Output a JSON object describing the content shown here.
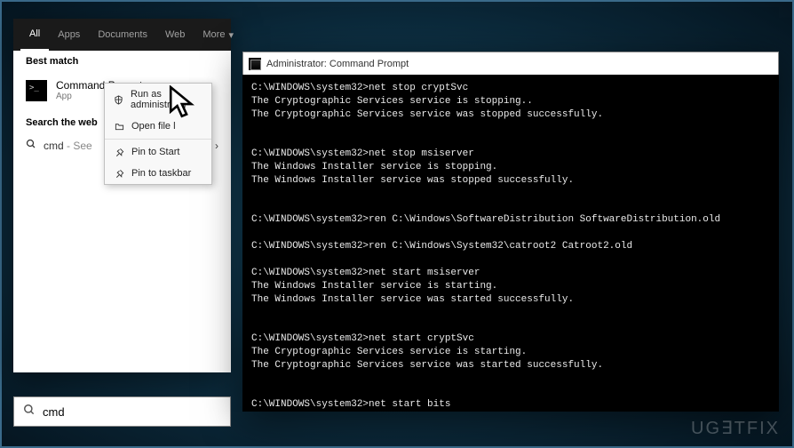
{
  "search_panel": {
    "tabs": [
      "All",
      "Apps",
      "Documents",
      "Web",
      "More"
    ],
    "active_tab": "All",
    "best_match_label": "Best match",
    "result": {
      "title": "Command Prompt",
      "subtitle": "App"
    },
    "search_web_label": "Search the web",
    "web_result": {
      "prefix": "cmd",
      "suffix": "- See"
    }
  },
  "context_menu": {
    "items": [
      {
        "label": "Run as administrator",
        "icon": "shield"
      },
      {
        "label": "Open file l",
        "icon": "folder"
      },
      {
        "label": "Pin to Start",
        "icon": "pin"
      },
      {
        "label": "Pin to taskbar",
        "icon": "pin"
      }
    ]
  },
  "search_input": {
    "value": "cmd"
  },
  "cmd_window": {
    "title": "Administrator: Command Prompt",
    "lines": [
      "C:\\WINDOWS\\system32>net stop cryptSvc",
      "The Cryptographic Services service is stopping..",
      "The Cryptographic Services service was stopped successfully.",
      "",
      "",
      "C:\\WINDOWS\\system32>net stop msiserver",
      "The Windows Installer service is stopping.",
      "The Windows Installer service was stopped successfully.",
      "",
      "",
      "C:\\WINDOWS\\system32>ren C:\\Windows\\SoftwareDistribution SoftwareDistribution.old",
      "",
      "C:\\WINDOWS\\system32>ren C:\\Windows\\System32\\catroot2 Catroot2.old",
      "",
      "C:\\WINDOWS\\system32>net start msiserver",
      "The Windows Installer service is starting.",
      "The Windows Installer service was started successfully.",
      "",
      "",
      "C:\\WINDOWS\\system32>net start cryptSvc",
      "The Cryptographic Services service is starting.",
      "The Cryptographic Services service was started successfully.",
      "",
      "",
      "C:\\WINDOWS\\system32>net start bits"
    ]
  },
  "watermark": "UG∃TFIX"
}
